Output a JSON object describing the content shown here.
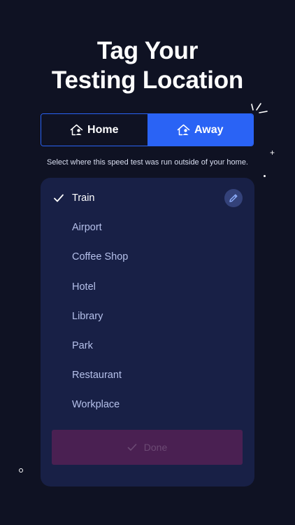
{
  "header": {
    "title_line1": "Tag Your",
    "title_line2": "Testing Location"
  },
  "toggle": {
    "home_label": "Home",
    "away_label": "Away",
    "selected": "Away"
  },
  "helper_text": "Select where this speed test was run outside of your home.",
  "locations": {
    "items": [
      {
        "label": "Train",
        "selected": true
      },
      {
        "label": "Airport",
        "selected": false
      },
      {
        "label": "Coffee Shop",
        "selected": false
      },
      {
        "label": "Hotel",
        "selected": false
      },
      {
        "label": "Library",
        "selected": false
      },
      {
        "label": "Park",
        "selected": false
      },
      {
        "label": "Restaurant",
        "selected": false
      },
      {
        "label": "Workplace",
        "selected": false
      }
    ]
  },
  "done_button": {
    "label": "Done",
    "enabled": false
  },
  "colors": {
    "background": "#0f1223",
    "accent": "#2a63f5",
    "panel": "#182046",
    "done_disabled": "#4a2052"
  },
  "icons": {
    "home_tab": "home-person-icon",
    "away_tab": "home-person-icon",
    "selected_mark": "checkmark-icon",
    "edit": "pencil-icon",
    "done": "checkmark-icon"
  }
}
